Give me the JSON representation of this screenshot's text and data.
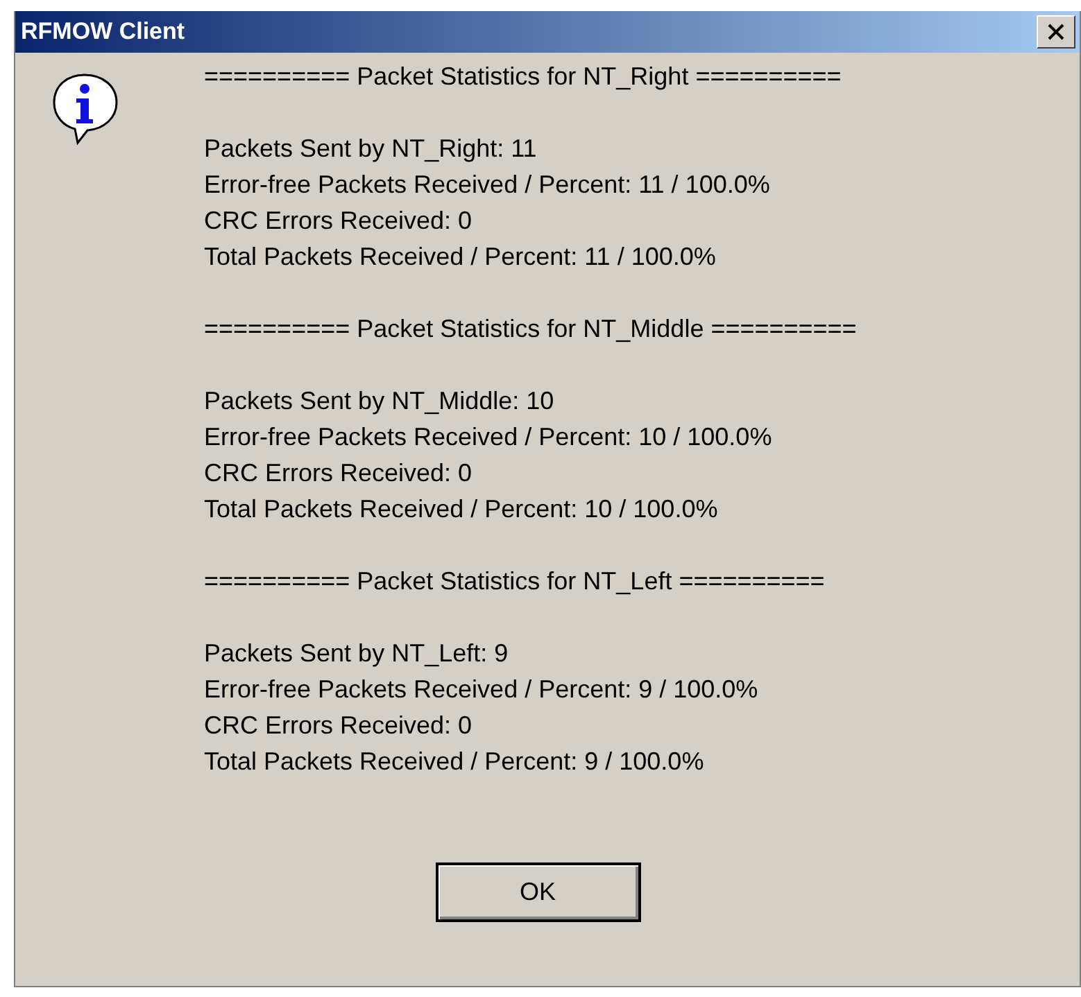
{
  "window": {
    "title": "RFMOW Client"
  },
  "sections": [
    {
      "header": "========== Packet Statistics for NT_Right ==========",
      "lines": [
        "Packets Sent by NT_Right: 11",
        "Error-free Packets Received / Percent: 11 / 100.0%",
        "CRC Errors Received: 0",
        "Total Packets Received / Percent: 11 / 100.0%"
      ]
    },
    {
      "header": "========== Packet Statistics for NT_Middle ==========",
      "lines": [
        "Packets Sent by NT_Middle: 10",
        "Error-free Packets Received / Percent: 10 / 100.0%",
        "CRC Errors Received: 0",
        "Total Packets Received / Percent: 10 / 100.0%"
      ]
    },
    {
      "header": "========== Packet Statistics for NT_Left ==========",
      "lines": [
        "Packets Sent by NT_Left: 9",
        "Error-free Packets Received / Percent: 9 / 100.0%",
        "CRC Errors Received: 0",
        "Total Packets Received / Percent: 9 / 100.0%"
      ]
    }
  ],
  "buttons": [
    "OK"
  ]
}
